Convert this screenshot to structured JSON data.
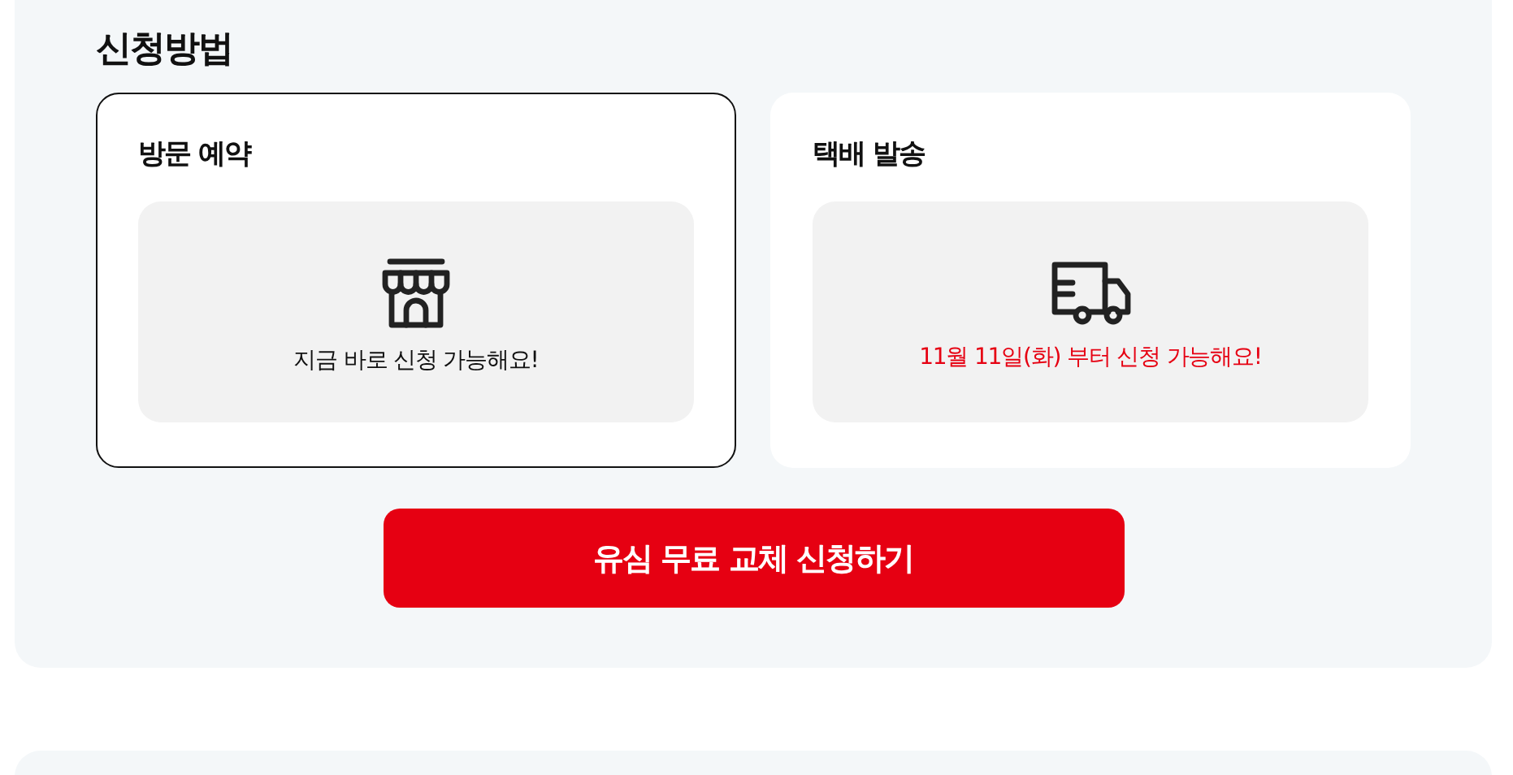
{
  "section_title": "신청방법",
  "methods": [
    {
      "title": "방문 예약",
      "kind": "store",
      "selected": true,
      "note": "지금 바로 신청 가능해요!",
      "note_emphasized": false
    },
    {
      "title": "택배 발송",
      "kind": "truck",
      "selected": false,
      "note": "11월 11일(화) 부터 신청 가능해요!",
      "note_emphasized": true
    }
  ],
  "apply_button": "유심 무료 교체 신청하기"
}
